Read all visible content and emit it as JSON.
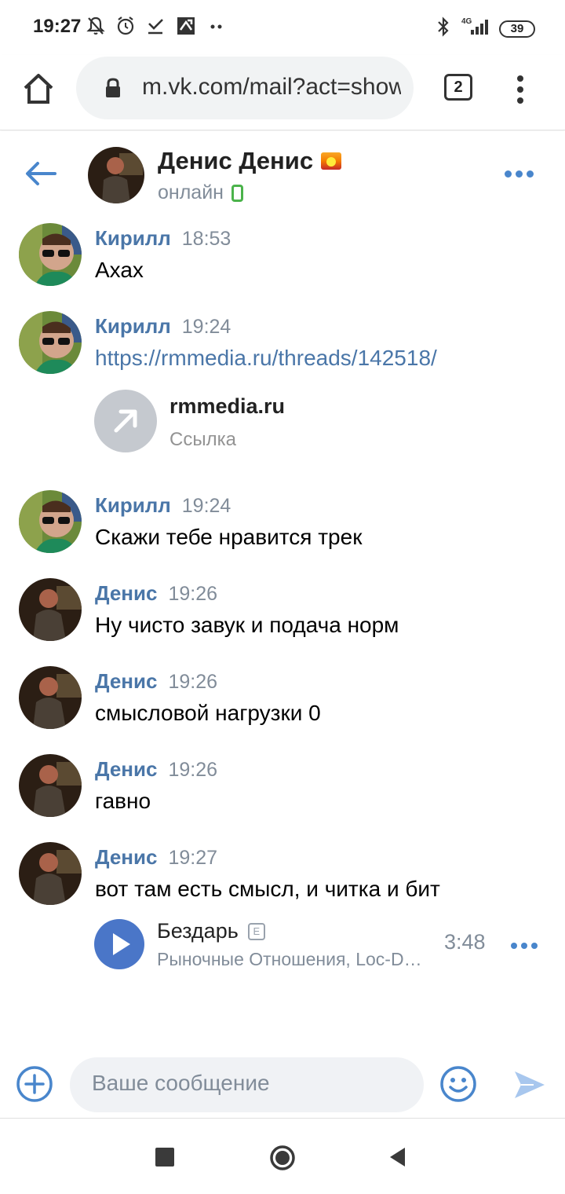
{
  "status_bar": {
    "time": "19:27",
    "network": "4G",
    "battery": "39"
  },
  "browser": {
    "url": "m.vk.com/mail?act=show",
    "tab_count": "2"
  },
  "chat": {
    "name": "Денис Денис",
    "status": "онлайн"
  },
  "messages": [
    {
      "author": "Кирилл",
      "time": "18:53",
      "text": "Ахах"
    },
    {
      "author": "Кирилл",
      "time": "19:24",
      "text": "https://rmmedia.ru/threads/142518/",
      "link_attachment": {
        "domain": "rmmedia.ru",
        "label": "Ссылка"
      }
    },
    {
      "author": "Кирилл",
      "time": "19:24",
      "text": "Скажи тебе нравится трек"
    },
    {
      "author": "Денис",
      "time": "19:26",
      "text": "Ну чисто завук и подача норм"
    },
    {
      "author": "Денис",
      "time": "19:26",
      "text": "смысловой нагрузки 0"
    },
    {
      "author": "Денис",
      "time": "19:26",
      "text": "гавно"
    },
    {
      "author": "Денис",
      "time": "19:27",
      "text": "вот там есть смысл, и читка и бит",
      "audio_attachment": {
        "title": "Бездарь",
        "explicit": "E",
        "artist": "Рыночные Отношения, Loc-Dog",
        "duration": "3:48"
      }
    }
  ],
  "composer": {
    "placeholder": "Ваше сообщение"
  },
  "colors": {
    "accent": "#4a76a8",
    "link_blue": "#4986cc",
    "online_green": "#4bb34b",
    "play_button": "#4a76c8"
  }
}
